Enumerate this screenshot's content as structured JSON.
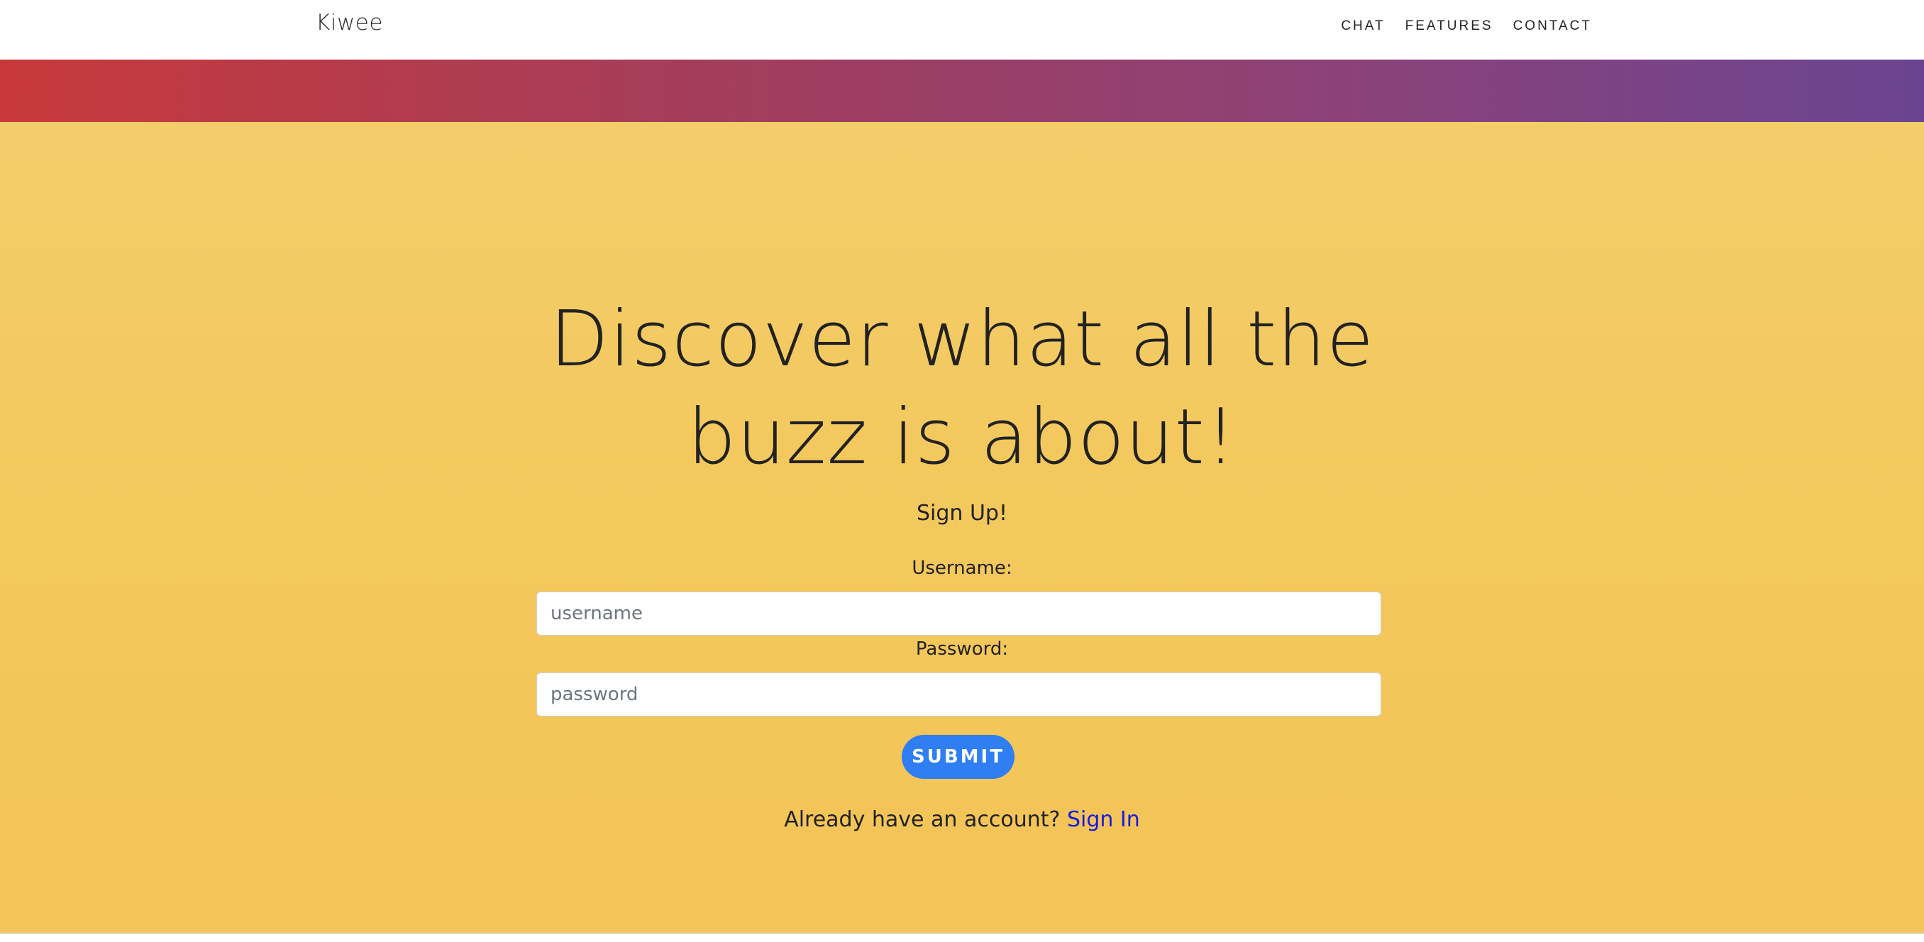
{
  "navbar": {
    "brand": "Kiwee",
    "links": [
      {
        "label": "CHAT"
      },
      {
        "label": "FEATURES"
      },
      {
        "label": "CONTACT"
      }
    ]
  },
  "hero": {
    "headline_line1": "Discover what all the",
    "headline_line2": "buzz is about!"
  },
  "signup": {
    "title": "Sign Up!",
    "username_label": "Username:",
    "username_placeholder": "username",
    "username_value": "",
    "password_label": "Password:",
    "password_placeholder": "password",
    "password_value": "",
    "submit_label": "SUBMIT",
    "signin_prompt": "Already have an account? ",
    "signin_link": "Sign In"
  },
  "colors": {
    "hero_background": "#f3c85a",
    "gradient_start": "#c8393b",
    "gradient_end": "#6a4491",
    "submit_button": "#2f7ef2",
    "link": "#1a1adf"
  }
}
